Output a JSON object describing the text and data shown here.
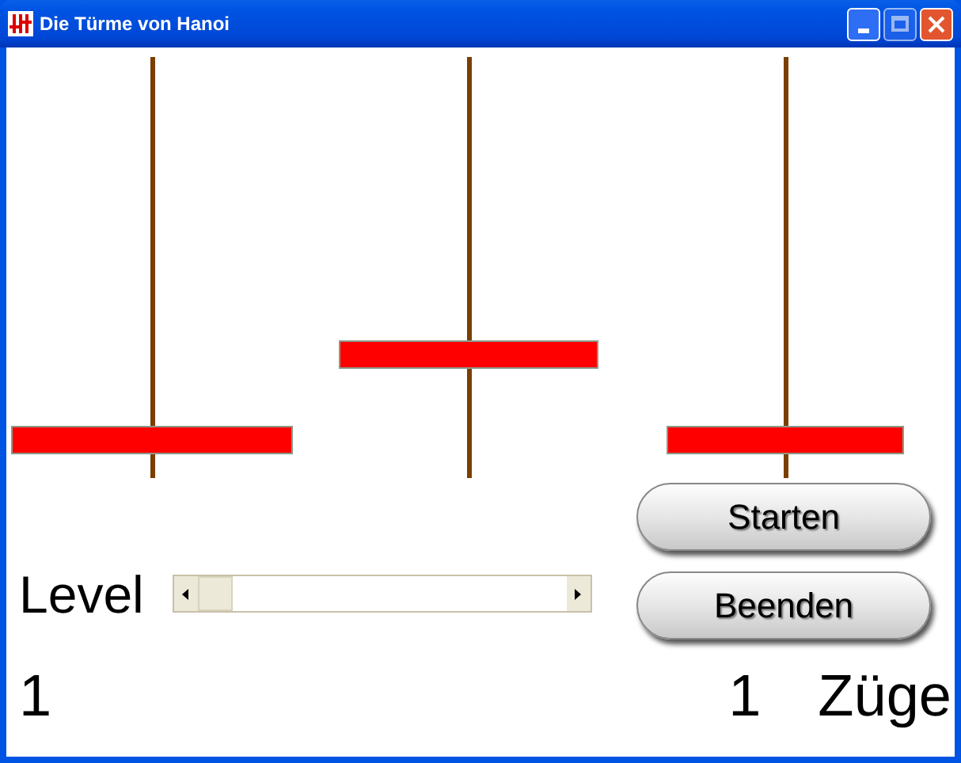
{
  "window": {
    "title": "Die Türme von Hanoi"
  },
  "level": {
    "label": "Level",
    "value": "1"
  },
  "buttons": [
    "Starten",
    "Beenden"
  ],
  "moves": {
    "count": "1",
    "label": "Züge"
  }
}
